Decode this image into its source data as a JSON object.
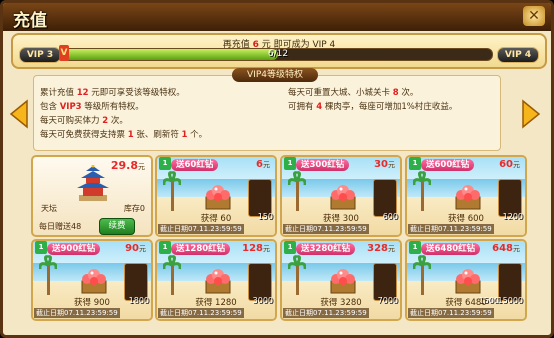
{
  "window": {
    "title": "充值",
    "close_icon": "close-icon"
  },
  "vip": {
    "tip_prefix": "再充值",
    "tip_amount": "6",
    "tip_suffix": "元 即可成为 VIP 4",
    "current": "VIP 3",
    "next": "VIP 4",
    "progress_text": "6/12",
    "progress": 0.5
  },
  "benefits": {
    "tab": "VIP4等级特权",
    "left": [
      [
        "累计充值 ",
        "12",
        " 元即可享受该等级特权。"
      ],
      [
        "包含 ",
        "VIP3",
        " 等级所有特权。"
      ],
      [
        "每天可购买体力 ",
        "2",
        " 次。"
      ],
      [
        "每天可免费获得支持票 ",
        "1",
        " 张、刷新符 ",
        "1",
        " 个。"
      ]
    ],
    "right": [
      [
        "每天可重置大城、小城关卡 ",
        "8",
        " 次。"
      ],
      [
        "可拥有 ",
        "4",
        " 棵肉亭，每座可增加1%村庄收益。"
      ]
    ]
  },
  "special": {
    "price": "29.8",
    "unit": "元",
    "name": "天坛",
    "stock": "库存0",
    "daily": "每日赠送48",
    "buy": "续费"
  },
  "cards": [
    {
      "badge": "送60红钻",
      "price": "6",
      "unit": "元",
      "gain": "获得 60",
      "gift": "150",
      "expire": "截止日期07.11.23:59:59"
    },
    {
      "badge": "送300红钻",
      "price": "30",
      "unit": "元",
      "gain": "获得 300",
      "gift": "600",
      "expire": "截止日期07.11.23:59:59"
    },
    {
      "badge": "送600红钻",
      "price": "60",
      "unit": "元",
      "gain": "获得 600",
      "gift": "1200",
      "expire": "截止日期07.11.23:59:59"
    },
    {
      "badge": "送900红钻",
      "price": "90",
      "unit": "元",
      "gain": "获得 900",
      "gift": "1800",
      "expire": "截止日期07.11.23:59:59"
    },
    {
      "badge": "送1280红钻",
      "price": "128",
      "unit": "元",
      "gain": "获得 1280",
      "gift": "3000",
      "expire": "截止日期07.11.23:59:59"
    },
    {
      "badge": "送3280红钻",
      "price": "328",
      "unit": "元",
      "gain": "获得 3280",
      "gift": "7000",
      "expire": "截止日期07.11.23:59:59"
    },
    {
      "badge": "送6480红钻",
      "price": "648",
      "unit": "元",
      "gain": "获得 6480",
      "gift": "15000",
      "gift2": "1500",
      "expire": "截止日期07.11.23:59:59"
    }
  ]
}
